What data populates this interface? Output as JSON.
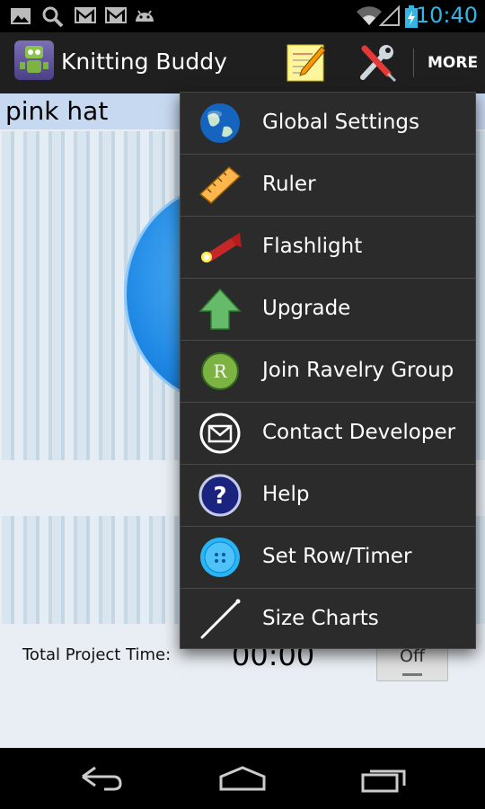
{
  "status_bar": {
    "time": "10:40",
    "icons": [
      "image-icon",
      "search-icon",
      "gmail-icon",
      "gmail-icon",
      "android-icon",
      "wifi-icon",
      "signal-icon",
      "battery-charging-icon"
    ]
  },
  "action_bar": {
    "app_title": "Knitting Buddy",
    "more_label": "MORE",
    "action_icons": [
      "notepad-pencil-icon",
      "wrench-screwdriver-icon"
    ]
  },
  "project": {
    "name": "pink hat",
    "total_time_label": "Total Project Time:",
    "total_time_value": "00:00",
    "toggle_label": "Off"
  },
  "overflow_menu": {
    "items": [
      {
        "label": "Global Settings",
        "icon": "globe-icon"
      },
      {
        "label": "Ruler",
        "icon": "ruler-icon"
      },
      {
        "label": "Flashlight",
        "icon": "flashlight-icon"
      },
      {
        "label": "Upgrade",
        "icon": "up-arrow-icon"
      },
      {
        "label": "Join Ravelry Group",
        "icon": "ravelry-icon"
      },
      {
        "label": "Contact Developer",
        "icon": "envelope-icon"
      },
      {
        "label": "Help",
        "icon": "help-icon"
      },
      {
        "label": "Set Row/Timer",
        "icon": "button-icon"
      },
      {
        "label": "Size Charts",
        "icon": "knitting-needle-icon"
      }
    ]
  },
  "colors": {
    "status_time": "#33b5e5",
    "action_bar_bg": "#1f1f1f",
    "menu_bg": "#2b2b2b",
    "project_bar_bg": "#c6d9f0"
  }
}
